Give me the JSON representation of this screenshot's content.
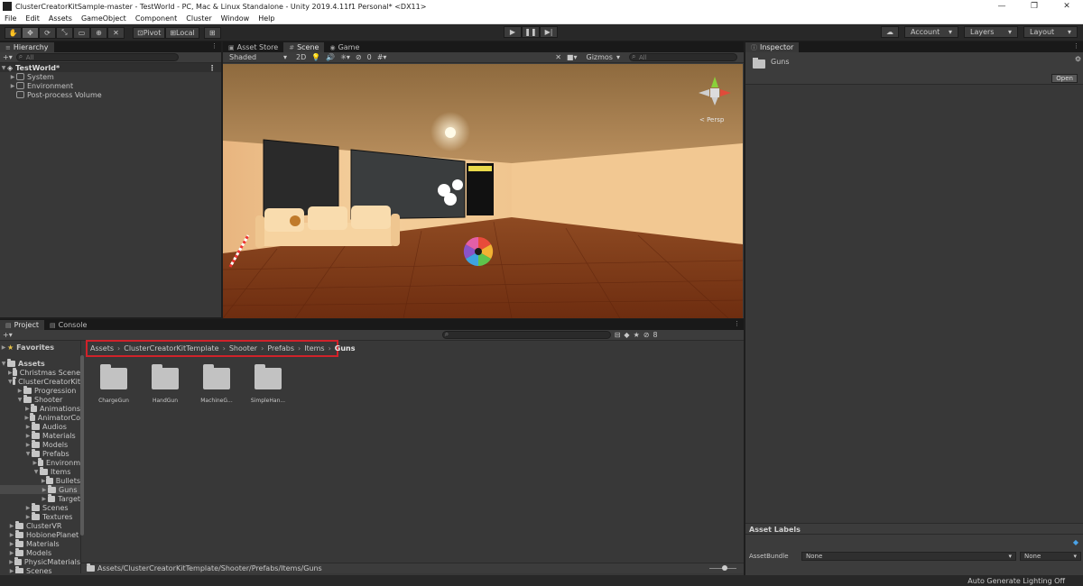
{
  "window": {
    "title": "ClusterCreatorKitSample-master - TestWorld - PC, Mac & Linux Standalone - Unity 2019.4.11f1 Personal* <DX11>",
    "minimize": "—",
    "restore": "❐",
    "close": "✕"
  },
  "menu": [
    "File",
    "Edit",
    "Assets",
    "GameObject",
    "Component",
    "Cluster",
    "Window",
    "Help"
  ],
  "toolbar": {
    "pivot": "Pivot",
    "local": "Local",
    "account": "Account",
    "layers": "Layers",
    "layout": "Layout"
  },
  "hierarchy": {
    "tab": "Hierarchy",
    "search_placeholder": "All",
    "scene": "TestWorld*",
    "items": [
      "System",
      "Environment",
      "Post-process Volume"
    ]
  },
  "center_tabs": [
    "Asset Store",
    "Scene",
    "Game"
  ],
  "scene_toolbar": {
    "shading": "Shaded",
    "mode_2d": "2D",
    "hidden_count": "0",
    "gizmos": "Gizmos",
    "search_placeholder": "All",
    "persp": "< Persp"
  },
  "project": {
    "tabs": [
      "Project",
      "Console"
    ],
    "favorites": "Favorites",
    "hidden_count": "8",
    "tree": [
      {
        "label": "Assets",
        "depth": 0,
        "open": true,
        "bold": true
      },
      {
        "label": "Christmas Scene",
        "depth": 1,
        "open": false
      },
      {
        "label": "ClusterCreatorKit",
        "depth": 1,
        "open": true
      },
      {
        "label": "Progression",
        "depth": 2,
        "open": false
      },
      {
        "label": "Shooter",
        "depth": 2,
        "open": true
      },
      {
        "label": "Animations",
        "depth": 3,
        "open": false
      },
      {
        "label": "AnimatorCo",
        "depth": 3,
        "open": false
      },
      {
        "label": "Audios",
        "depth": 3,
        "open": false
      },
      {
        "label": "Materials",
        "depth": 3,
        "open": false
      },
      {
        "label": "Models",
        "depth": 3,
        "open": false
      },
      {
        "label": "Prefabs",
        "depth": 3,
        "open": true
      },
      {
        "label": "Environm",
        "depth": 4,
        "open": false
      },
      {
        "label": "Items",
        "depth": 4,
        "open": true
      },
      {
        "label": "Bullets",
        "depth": 5,
        "open": false
      },
      {
        "label": "Guns",
        "depth": 5,
        "open": false,
        "selected": true
      },
      {
        "label": "Target",
        "depth": 5,
        "open": false
      },
      {
        "label": "Scenes",
        "depth": 3,
        "open": false
      },
      {
        "label": "Textures",
        "depth": 3,
        "open": false
      },
      {
        "label": "ClusterVR",
        "depth": 1,
        "open": false
      },
      {
        "label": "HobionePlanet",
        "depth": 1,
        "open": false
      },
      {
        "label": "Materials",
        "depth": 1,
        "open": false
      },
      {
        "label": "Models",
        "depth": 1,
        "open": false
      },
      {
        "label": "PhysicMaterials",
        "depth": 1,
        "open": false
      },
      {
        "label": "Scenes",
        "depth": 1,
        "open": false
      }
    ],
    "breadcrumb": [
      "Assets",
      "ClusterCreatorKitTemplate",
      "Shooter",
      "Prefabs",
      "Items",
      "Guns"
    ],
    "assets": [
      "ChargeGun",
      "HandGun",
      "MachineG...",
      "SimpleHan..."
    ],
    "status_path": "Assets/ClusterCreatorKitTemplate/Shooter/Prefabs/Items/Guns"
  },
  "inspector": {
    "tab": "Inspector",
    "name": "Guns",
    "open_button": "Open",
    "asset_labels_title": "Asset Labels",
    "asset_bundle_label": "AssetBundle",
    "asset_bundle_value": "None",
    "asset_variant_value": "None"
  },
  "status_bar": {
    "lighting": "Auto Generate Lighting Off"
  },
  "colors": {
    "breadcrumb_highlight": "#d0222a",
    "ceiling": "#a8804f",
    "wall": "#f0c796",
    "floor": "#7a3516"
  }
}
